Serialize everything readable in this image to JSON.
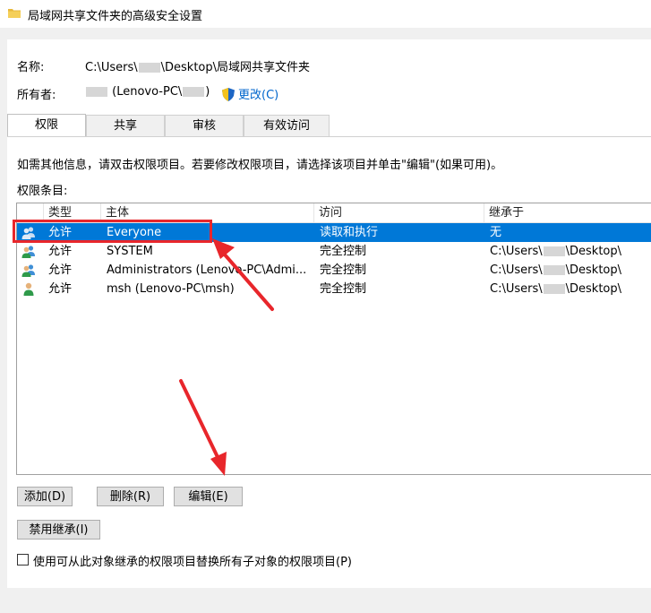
{
  "window": {
    "title": "局域网共享文件夹的高级安全设置",
    "folder_icon": "folder-icon"
  },
  "info": {
    "name_label": "名称:",
    "path_prefix": "C:\\Users\\",
    "path_suffix": "\\Desktop\\局域网共享文件夹",
    "owner_label": "所有者:",
    "owner_value_prefix": "(Lenovo-PC\\",
    "owner_value_suffix": ")",
    "change_link": "更改(C)"
  },
  "tabs": [
    {
      "label": "权限",
      "active": true
    },
    {
      "label": "共享",
      "active": false
    },
    {
      "label": "审核",
      "active": false
    },
    {
      "label": "有效访问",
      "active": false
    }
  ],
  "instructions": "如需其他信息，请双击权限项目。若要修改权限项目，请选择该项目并单击\"编辑\"(如果可用)。",
  "entries_label": "权限条目:",
  "table": {
    "columns": [
      "类型",
      "主体",
      "访问",
      "继承于"
    ],
    "rows": [
      {
        "type": "允许",
        "principal": "Everyone",
        "access": "读取和执行",
        "inherited": "无",
        "icon": "group-users-icon",
        "selected": true
      },
      {
        "type": "允许",
        "principal": "SYSTEM",
        "access": "完全控制",
        "inherited_prefix": "C:\\Users\\",
        "inherited_suffix": "\\Desktop\\",
        "icon": "group-users-icon",
        "selected": false
      },
      {
        "type": "允许",
        "principal": "Administrators (Lenovo-PC\\Admi...",
        "access": "完全控制",
        "inherited_prefix": "C:\\Users\\",
        "inherited_suffix": "\\Desktop\\",
        "icon": "group-users-icon",
        "selected": false
      },
      {
        "type": "允许",
        "principal": "msh (Lenovo-PC\\msh)",
        "access": "完全控制",
        "inherited_prefix": "C:\\Users\\",
        "inherited_suffix": "\\Desktop\\",
        "icon": "single-user-icon",
        "selected": false
      }
    ]
  },
  "buttons": {
    "add": "添加(D)",
    "remove": "删除(R)",
    "edit": "编辑(E)",
    "disable_inheritance": "禁用继承(I)"
  },
  "checkbox": {
    "label": "使用可从此对象继承的权限项目替换所有子对象的权限项目(P)",
    "checked": false
  },
  "colors": {
    "selection": "#0078d7",
    "annotation_red": "#e8262b",
    "link": "#0066cc"
  }
}
